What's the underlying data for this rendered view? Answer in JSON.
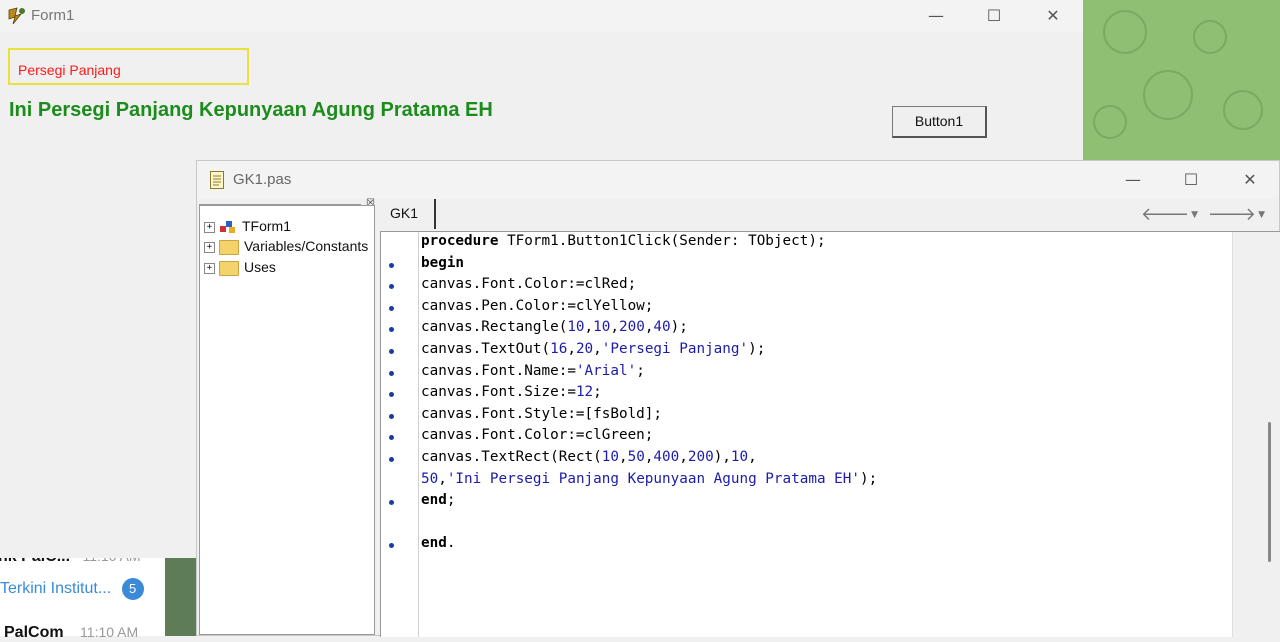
{
  "form1": {
    "title": "Form1",
    "rect_text": "Persegi Panjang",
    "green_text": "Ini Persegi Panjang Kepunyaan Agung Pratama EH",
    "button_label": "Button1",
    "window_buttons": [
      "—",
      "☐",
      "✕"
    ]
  },
  "editor": {
    "title": "GK1.pas",
    "window_buttons": [
      "—",
      "☐",
      "✕"
    ],
    "tree": [
      {
        "label": "TForm1",
        "icon": "class-icon"
      },
      {
        "label": "Variables/Constants",
        "icon": "folder-icon"
      },
      {
        "label": "Uses",
        "icon": "folder-icon"
      }
    ],
    "tab": "GK1",
    "code_lines": [
      {
        "text": "procedure TForm1.Button1Click(Sender: TObject);",
        "dot": false
      },
      {
        "text": "begin",
        "dot": true
      },
      {
        "text": "canvas.Font.Color:=clRed;",
        "dot": true
      },
      {
        "text": "canvas.Pen.Color:=clYellow;",
        "dot": true
      },
      {
        "text": "canvas.Rectangle(10,10,200,40);",
        "dot": true
      },
      {
        "text": "canvas.TextOut(16,20,'Persegi Panjang');",
        "dot": true
      },
      {
        "text": "canvas.Font.Name:='Arial';",
        "dot": true
      },
      {
        "text": "canvas.Font.Size:=12;",
        "dot": true
      },
      {
        "text": "canvas.Font.Style:=[fsBold];",
        "dot": true
      },
      {
        "text": "canvas.Font.Color:=clGreen;",
        "dot": true
      },
      {
        "text": "canvas.TextRect(Rect(10,50,400,200),10,",
        "dot": true
      },
      {
        "text": "50,'Ini Persegi Panjang Kepunyaan Agung Pratama EH');",
        "dot": false
      },
      {
        "text": "end;",
        "dot": true
      },
      {
        "text": "",
        "dot": false
      },
      {
        "text": "end.",
        "dot": true
      }
    ]
  },
  "chat": {
    "row1_name": "nk PalC...",
    "row1_time": "11:10 AM",
    "row2_text": "Terkini Institut...",
    "row2_badge": "5",
    "row3_name": "PalCom",
    "row3_time": "11:10 AM"
  },
  "colors": {
    "rect_border": "#e8e23a",
    "rect_text": "#ff1a1a",
    "green_text": "#1c8c1c",
    "wallpaper": "#8fbf73",
    "code_number": "#1c1caa"
  }
}
